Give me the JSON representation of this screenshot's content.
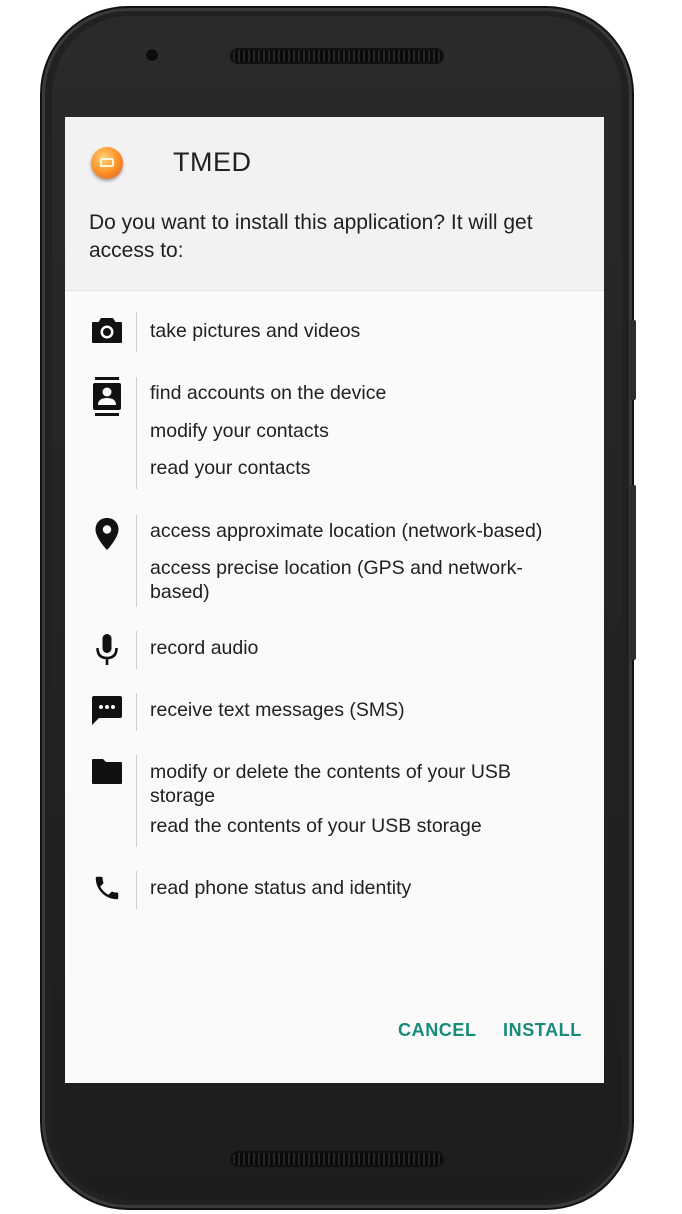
{
  "dialog": {
    "app_name": "TMED",
    "app_icon": "app-logo-icon",
    "question": "Do you want to install this application? It will get access to:"
  },
  "permissions": [
    {
      "icon": "camera-icon",
      "lines": [
        "take pictures and videos"
      ]
    },
    {
      "icon": "contacts-icon",
      "lines": [
        "find accounts on the device",
        "modify your contacts",
        "read your contacts"
      ]
    },
    {
      "icon": "location-pin-icon",
      "lines": [
        "access approximate location (network-based)",
        "access precise location (GPS and network-based)"
      ]
    },
    {
      "icon": "microphone-icon",
      "lines": [
        "record audio"
      ]
    },
    {
      "icon": "sms-icon",
      "lines": [
        "receive text messages (SMS)"
      ]
    },
    {
      "icon": "folder-icon",
      "lines": [
        "modify or delete the contents of your USB storage",
        "read the contents of your USB storage"
      ]
    },
    {
      "icon": "phone-icon",
      "lines": [
        "read phone status and identity"
      ]
    }
  ],
  "actions": {
    "cancel_label": "CANCEL",
    "install_label": "INSTALL"
  },
  "colors": {
    "accent": "#168b7a",
    "text": "#212121",
    "phone_body": "#212121"
  }
}
